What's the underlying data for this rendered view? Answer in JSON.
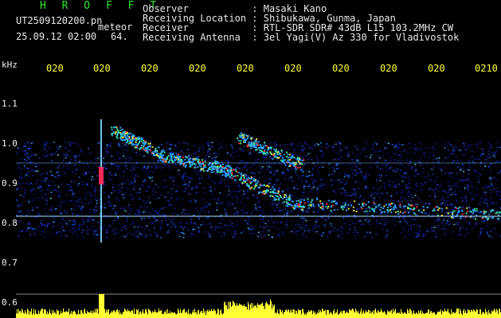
{
  "header": {
    "logo": "H R O F F T",
    "filename": "UT2509120200.pn",
    "detection_label": "meteor",
    "timestamp": "25.09.12 02:00",
    "count": "64.",
    "observer": "Observer           : Masaki Kano",
    "location": "Receiving Location : Shibukawa, Gunma, Japan",
    "receiver": "Receiver           : RTL-SDR SDR# 43dB L15 103.2MHz CW",
    "antenna": "Receiving Antenna  : 3el Yagi(V) Az 330 for Vladivostok"
  },
  "axis": {
    "unit": "kHz",
    "y_ticks": [
      "1.1",
      "1.0",
      "0.9",
      "0.8",
      "0.7",
      "0.6"
    ],
    "time_labels": [
      "020",
      "020",
      "020",
      "020",
      "020",
      "020",
      "020",
      "020",
      "020",
      "0210"
    ]
  },
  "colors": {
    "accent": "#2ee82e",
    "time": "#ffff33",
    "background": "#000000"
  }
}
